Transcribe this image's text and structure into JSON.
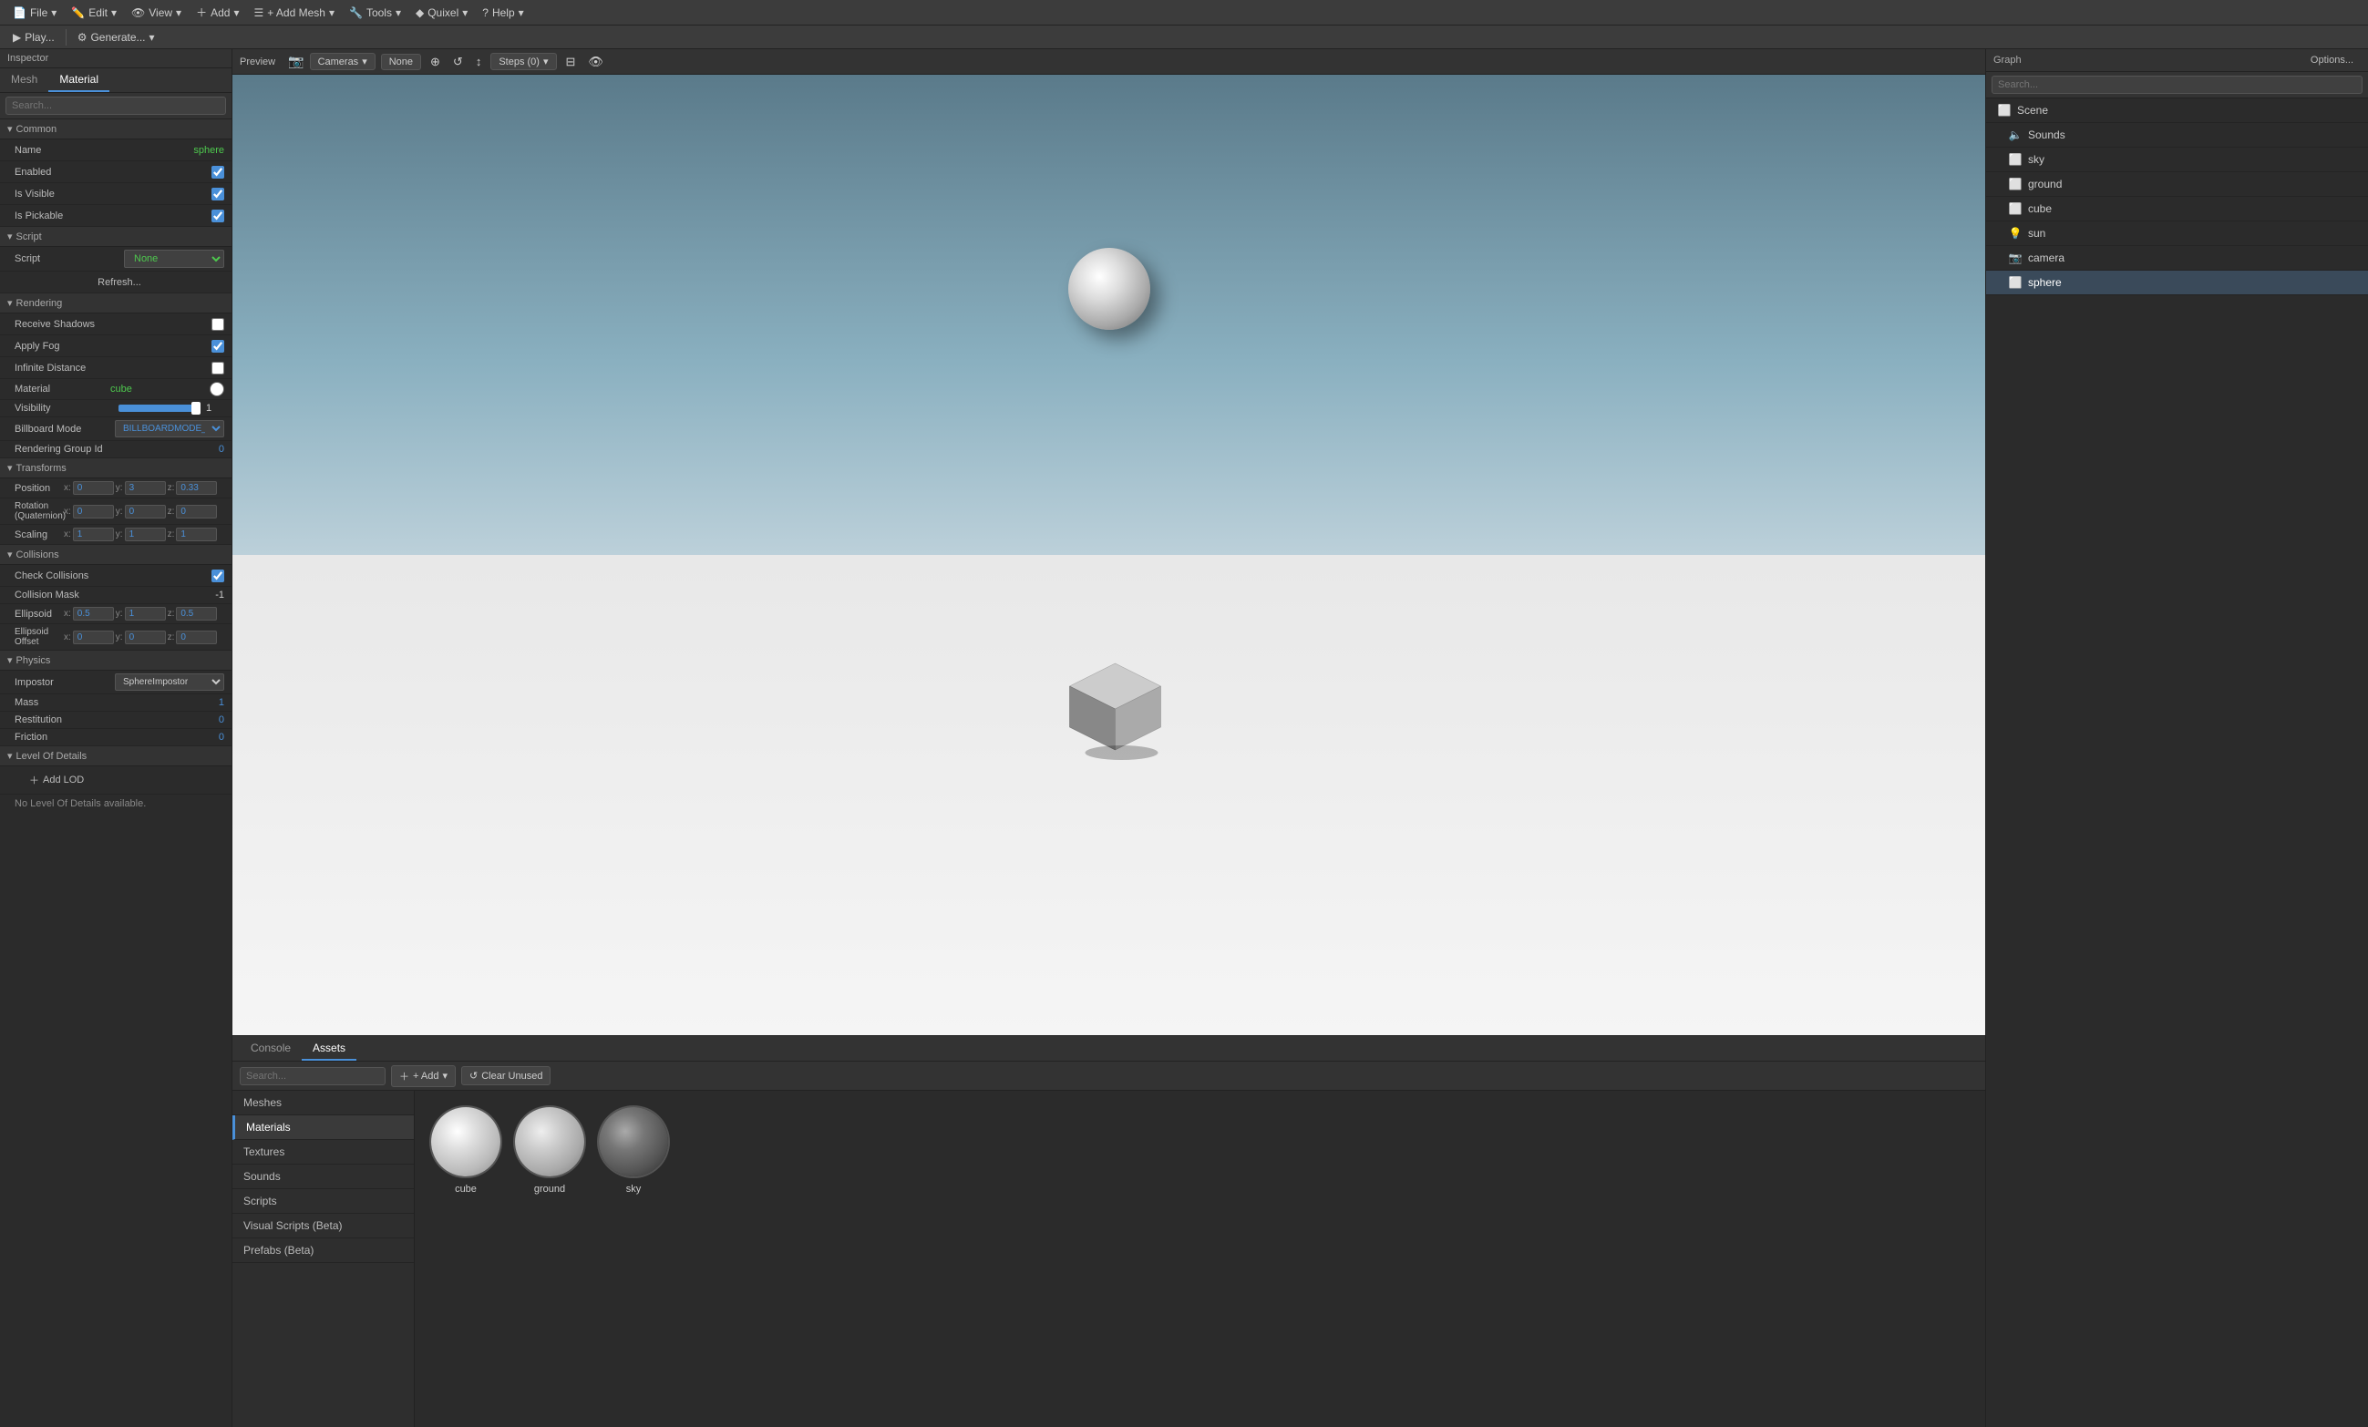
{
  "topToolbar": {
    "items": [
      {
        "label": "File",
        "id": "file"
      },
      {
        "label": "Edit",
        "id": "edit"
      },
      {
        "label": "View",
        "id": "view"
      },
      {
        "label": "Add",
        "id": "add"
      },
      {
        "label": "+ Add Mesh",
        "id": "add-mesh"
      },
      {
        "label": "Tools",
        "id": "tools"
      },
      {
        "label": "Quixel",
        "id": "quixel"
      },
      {
        "label": "Help",
        "id": "help"
      }
    ]
  },
  "secondToolbar": {
    "play": "Play...",
    "generate": "Generate..."
  },
  "inspector": {
    "title": "Inspector",
    "tabs": [
      {
        "label": "Mesh",
        "active": false
      },
      {
        "label": "Material",
        "active": true
      }
    ],
    "search_placeholder": "Search...",
    "sections": {
      "common": {
        "label": "Common",
        "name": {
          "label": "Name",
          "value": "sphere"
        },
        "enabled": {
          "label": "Enabled",
          "checked": true
        },
        "isVisible": {
          "label": "Is Visible",
          "checked": true
        },
        "isPickable": {
          "label": "Is Pickable",
          "checked": true
        }
      },
      "script": {
        "label": "Script",
        "script": {
          "label": "Script",
          "value": "None"
        },
        "refresh": "Refresh..."
      },
      "rendering": {
        "label": "Rendering",
        "receiveShadows": {
          "label": "Receive Shadows",
          "checked": false
        },
        "applyFog": {
          "label": "Apply Fog",
          "checked": true
        },
        "infiniteDistance": {
          "label": "Infinite Distance",
          "checked": false
        },
        "material": {
          "label": "Material",
          "value": "cube"
        },
        "visibility": {
          "label": "Visibility",
          "value": 1
        },
        "billboardMode": {
          "label": "Billboard Mode",
          "value": "BILLBOARDMODE_NONE"
        },
        "renderingGroupId": {
          "label": "Rendering Group Id",
          "value": "0"
        }
      },
      "transforms": {
        "label": "Transforms",
        "position": {
          "label": "Position",
          "x": "0",
          "y": "3",
          "z": "0.33"
        },
        "rotation": {
          "label": "Rotation (Quaternion)",
          "x": "0",
          "y": "0",
          "z": "0"
        },
        "scaling": {
          "label": "Scaling",
          "x": "1",
          "y": "1",
          "z": "1"
        }
      },
      "collisions": {
        "label": "Collisions",
        "checkCollisions": {
          "label": "Check Collisions",
          "checked": true
        },
        "collisionMask": {
          "label": "Collision Mask",
          "value": "-1"
        },
        "ellipsoid": {
          "label": "Ellipsoid",
          "x": "0.5",
          "y": "1",
          "z": "0.5"
        },
        "ellipsoidOffset": {
          "label": "Ellipsoid Offset",
          "x": "0",
          "y": "0",
          "z": "0"
        }
      },
      "physics": {
        "label": "Physics",
        "impostor": {
          "label": "Impostor",
          "value": "SphereImpostor"
        },
        "mass": {
          "label": "Mass",
          "value": "1"
        },
        "restitution": {
          "label": "Restitution",
          "value": "0"
        },
        "friction": {
          "label": "Friction",
          "value": "0"
        }
      },
      "lod": {
        "label": "Level Of Details",
        "addLod": "Add LOD",
        "noLod": "No Level Of Details available."
      }
    }
  },
  "preview": {
    "title": "Preview",
    "cameras_label": "Cameras",
    "none_label": "None",
    "steps_label": "Steps (0)"
  },
  "bottomPanel": {
    "tabs": [
      {
        "label": "Console",
        "active": false
      },
      {
        "label": "Assets",
        "active": true
      }
    ],
    "assets": {
      "search_placeholder": "Search...",
      "add_label": "+ Add",
      "clear_unused_label": "Clear Unused",
      "nav": [
        {
          "label": "Meshes",
          "active": false
        },
        {
          "label": "Materials",
          "active": true
        },
        {
          "label": "Textures",
          "active": false
        },
        {
          "label": "Sounds",
          "active": false
        },
        {
          "label": "Scripts",
          "active": false
        },
        {
          "label": "Visual Scripts (Beta)",
          "active": false
        },
        {
          "label": "Prefabs (Beta)",
          "active": false
        }
      ],
      "items": [
        {
          "name": "cube",
          "thumb": "white"
        },
        {
          "name": "ground",
          "thumb": "light"
        },
        {
          "name": "sky",
          "thumb": "dark"
        }
      ]
    }
  },
  "graph": {
    "title": "Graph",
    "search_placeholder": "Search...",
    "options_label": "Options...",
    "tree": [
      {
        "label": "Scene",
        "icon": "scene",
        "active": false
      },
      {
        "label": "Sounds",
        "icon": "sounds",
        "active": false
      },
      {
        "label": "sky",
        "icon": "sky",
        "active": false
      },
      {
        "label": "ground",
        "icon": "ground",
        "active": false
      },
      {
        "label": "cube",
        "icon": "cube",
        "active": false
      },
      {
        "label": "sun",
        "icon": "sun",
        "active": false
      },
      {
        "label": "camera",
        "icon": "camera",
        "active": false
      },
      {
        "label": "sphere",
        "icon": "sphere",
        "active": true
      }
    ]
  }
}
